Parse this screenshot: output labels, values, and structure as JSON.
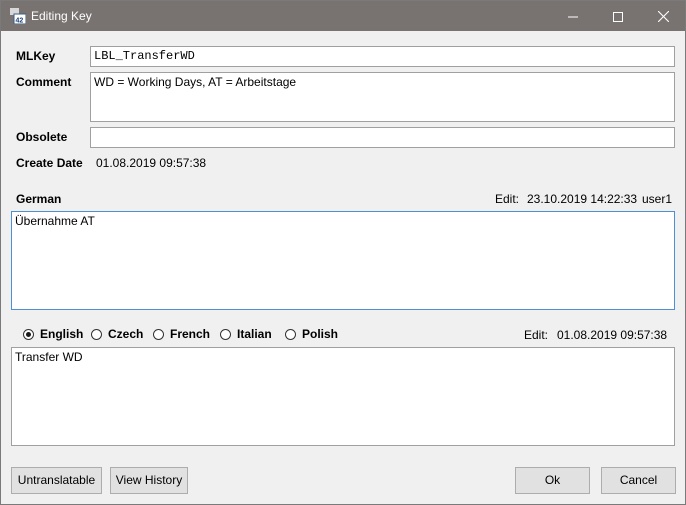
{
  "window": {
    "title": "Editing Key"
  },
  "titlebar": {
    "minimize": "—",
    "maximize": "☐",
    "close": "✕"
  },
  "form": {
    "mlkey_label": "MLKey",
    "mlkey_value": "LBL_TransferWD",
    "comment_label": "Comment",
    "comment_value": "WD = Working Days, AT = Arbeitstage",
    "obsolete_label": "Obsolete",
    "obsolete_value": "",
    "create_date_label": "Create Date",
    "create_date_value": "01.08.2019 09:57:38"
  },
  "german": {
    "label": "German",
    "edit_label": "Edit:",
    "edit_date": "23.10.2019 14:22:33",
    "edit_user": "user1",
    "text": "Übernahme AT"
  },
  "languages": {
    "options": [
      "English",
      "Czech",
      "French",
      "Italian",
      "Polish"
    ],
    "selected": "English",
    "edit_label": "Edit:",
    "edit_date": "01.08.2019 09:57:38",
    "text": "Transfer WD"
  },
  "buttons": {
    "untranslatable": "Untranslatable",
    "view_history": "View History",
    "ok": "Ok",
    "cancel": "Cancel"
  }
}
